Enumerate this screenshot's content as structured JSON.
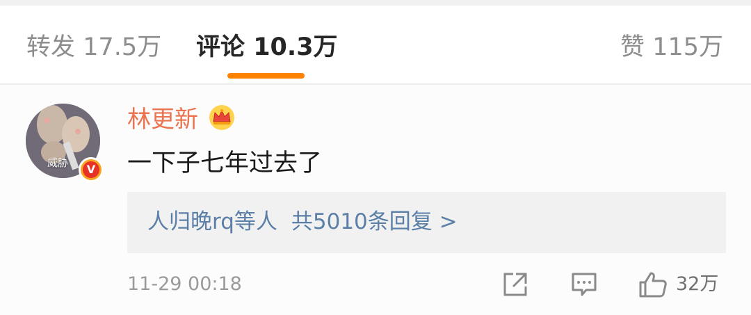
{
  "tabs": [
    {
      "label": "转发",
      "count": "17.5万"
    },
    {
      "label": "评论",
      "count": "10.3万"
    },
    {
      "label": "赞",
      "count": "115万"
    }
  ],
  "active_tab": "评论",
  "colors": {
    "accent": "#ff8200",
    "username": "#eb7350",
    "link": "#5b7fa6",
    "muted": "#9a9a9a"
  },
  "comment": {
    "avatar_label": "威胁",
    "username": "林更新",
    "text": "一下子七年过去了",
    "replies": {
      "users": "人归晚rq等人",
      "count_label": "共5010条回复 >"
    },
    "time": "11-29 00:18",
    "like_count": "32万",
    "icons": [
      "crown-icon",
      "verified-v-icon",
      "share-icon",
      "reply-icon",
      "like-icon"
    ]
  }
}
